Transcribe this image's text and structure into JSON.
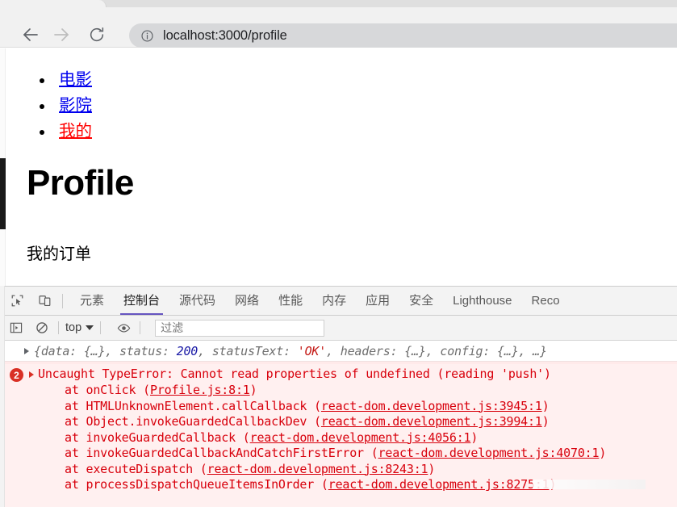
{
  "browser": {
    "back_label": "Back",
    "forward_label": "Forward",
    "reload_label": "Reload",
    "url": "localhost:3000/profile",
    "site_info_label": "View site information"
  },
  "page": {
    "nav_links": [
      {
        "label": "电影",
        "state": "unvisited"
      },
      {
        "label": "影院",
        "state": "unvisited"
      },
      {
        "label": "我的",
        "state": "active"
      }
    ],
    "heading": "Profile",
    "subtext": "我的订单"
  },
  "devtools": {
    "inspect_icon": "inspect-element-icon",
    "device_icon": "device-toolbar-icon",
    "tabs": [
      {
        "label": "元素",
        "active": false
      },
      {
        "label": "控制台",
        "active": true
      },
      {
        "label": "源代码",
        "active": false
      },
      {
        "label": "网络",
        "active": false
      },
      {
        "label": "性能",
        "active": false
      },
      {
        "label": "内存",
        "active": false
      },
      {
        "label": "应用",
        "active": false
      },
      {
        "label": "安全",
        "active": false
      },
      {
        "label": "Lighthouse",
        "active": false
      },
      {
        "label": "Reco",
        "active": false
      }
    ],
    "accent_color": "#6554c0",
    "filterbar": {
      "sidebar_icon": "console-sidebar-icon",
      "clear_icon": "clear-console-icon",
      "context": "top",
      "eye_icon": "live-expression-icon",
      "filter_placeholder": "过滤"
    },
    "console": {
      "object_message": {
        "prefix": "{data: {…}, status: ",
        "status_value": "200",
        "mid": ", statusText: ",
        "status_text": "'OK'",
        "suffix": ", headers: {…}, config: {…}, …}"
      },
      "error": {
        "count": "2",
        "message": "Uncaught TypeError: Cannot read properties of undefined (reading 'push')",
        "stack": [
          {
            "fn": "at onClick (",
            "loc": "Profile.js:8:1",
            "close": ")"
          },
          {
            "fn": "at HTMLUnknownElement.callCallback (",
            "loc": "react-dom.development.js:3945:1",
            "close": ")"
          },
          {
            "fn": "at Object.invokeGuardedCallbackDev (",
            "loc": "react-dom.development.js:3994:1",
            "close": ")"
          },
          {
            "fn": "at invokeGuardedCallback (",
            "loc": "react-dom.development.js:4056:1",
            "close": ")"
          },
          {
            "fn": "at invokeGuardedCallbackAndCatchFirstError (",
            "loc": "react-dom.development.js:4070:1",
            "close": ")"
          },
          {
            "fn": "at executeDispatch (",
            "loc": "react-dom.development.js:8243:1",
            "close": ")"
          },
          {
            "fn": "at processDispatchQueueItemsInOrder (",
            "loc": "react-dom.development.js:8275:1",
            "close": ")"
          }
        ],
        "error_color": "#d8000c",
        "background_color": "#fff0f0"
      }
    }
  }
}
